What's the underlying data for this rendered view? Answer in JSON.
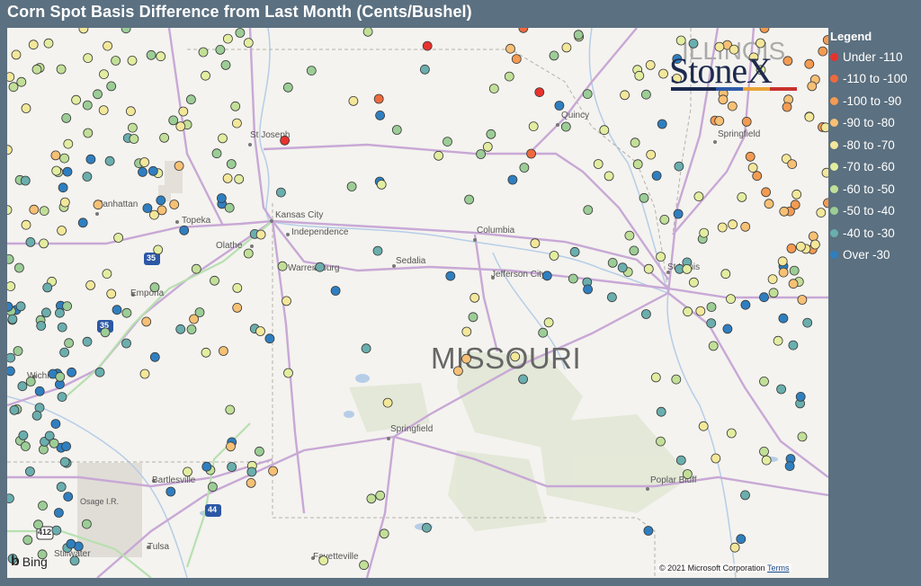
{
  "title": "Corn Spot Basis Difference from Last Month (Cents/Bushel)",
  "legend": {
    "title": "Legend",
    "items": [
      {
        "label": "Under -110",
        "color": "#e8322e"
      },
      {
        "label": "-110 to -100",
        "color": "#ee6a3e"
      },
      {
        "label": "-100 to -90",
        "color": "#f39b52"
      },
      {
        "label": "-90 to -80",
        "color": "#f6c075"
      },
      {
        "label": "-80 to -70",
        "color": "#f3e79a"
      },
      {
        "label": "-70 to -60",
        "color": "#e3eda0"
      },
      {
        "label": "-60 to -50",
        "color": "#c2df98"
      },
      {
        "label": "-50 to -40",
        "color": "#9ccd96"
      },
      {
        "label": "-40 to -30",
        "color": "#6aaeae"
      },
      {
        "label": "Over -30",
        "color": "#2f7fc0"
      }
    ]
  },
  "map": {
    "state_label": "MISSOURI",
    "places": [
      "St Joseph",
      "Manhattan",
      "Topeka",
      "Kansas City",
      "Independence",
      "Olathe",
      "Columbia",
      "Emporia",
      "Warrensburg",
      "Sedalia",
      "Jefferson City",
      "St Louis",
      "Springfield",
      "Wichita",
      "Springfield",
      "Bartlesville",
      "Osage I.R.",
      "Poplar Bluff",
      "Tulsa",
      "Stillwater",
      "Fayetteville",
      "Quincy",
      "ILLINOIS"
    ],
    "highway_shields": [
      "35",
      "35",
      "44",
      "412"
    ]
  },
  "logo": {
    "text": "StoneX",
    "bar_colors": [
      "#1d2a4e",
      "#2f5aa8",
      "#e8a33a",
      "#c8322e"
    ]
  },
  "attribution": {
    "bing": "Bing",
    "copyright": "© 2021 Microsoft Corporation",
    "terms": "Terms"
  }
}
